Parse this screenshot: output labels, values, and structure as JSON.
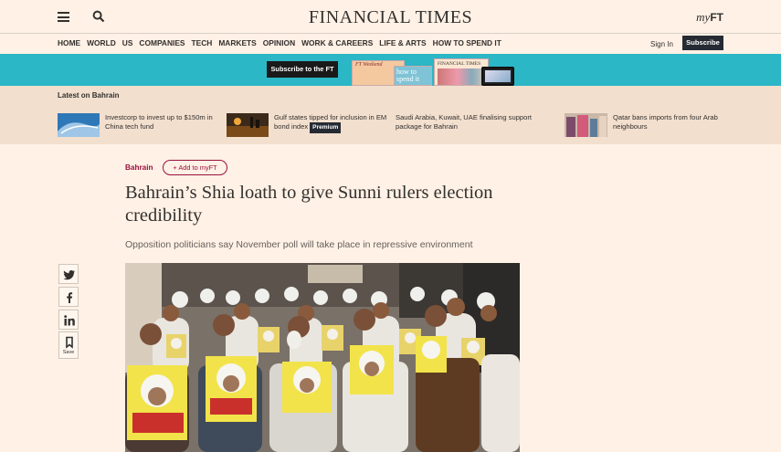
{
  "header": {
    "masthead": "FINANCIAL TIMES",
    "myft_prefix": "my",
    "myft_suffix": "FT"
  },
  "nav": {
    "items": [
      "HOME",
      "WORLD",
      "US",
      "COMPANIES",
      "TECH",
      "MARKETS",
      "OPINION",
      "WORK & CAREERS",
      "LIFE & ARTS",
      "HOW TO SPEND IT"
    ],
    "signin": "Sign In",
    "subscribe": "Subscribe"
  },
  "promo": {
    "button": "Subscribe to the FT",
    "papers": [
      "FT Weekend",
      "how to spend it",
      "FINANCIAL TIMES"
    ]
  },
  "latest": {
    "title": "Latest on Bahrain",
    "stories": [
      {
        "text": "Investcorp to invest up to $150m in China tech fund",
        "badge": ""
      },
      {
        "text": "Gulf states tipped for inclusion in EM bond index",
        "badge": "Premium"
      },
      {
        "text": "Saudi Arabia, Kuwait, UAE finalising support package for Bahrain",
        "badge": ""
      },
      {
        "text": "Qatar bans imports from four Arab neighbours",
        "badge": ""
      }
    ]
  },
  "article": {
    "topic": "Bahrain",
    "add_myft": "+ Add to myFT",
    "headline": "Bahrain’s Shia loath to give Sunni rulers election credibility",
    "standfirst": "Opposition politicians say November poll will take place in repressive environment",
    "save_label": "Save"
  },
  "colors": {
    "page_bg": "#fff1e5",
    "promo_bg": "#2bb7c6",
    "latest_bg": "#f2dfce",
    "claret": "#990f3d",
    "dark_button": "#262a33"
  }
}
